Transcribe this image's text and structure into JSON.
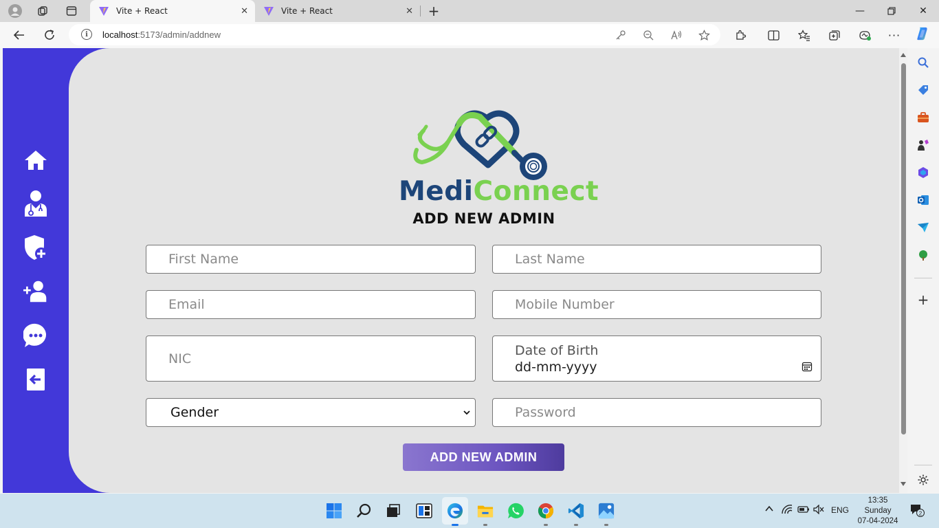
{
  "browser": {
    "tabs": [
      {
        "title": "Vite + React",
        "active": true
      },
      {
        "title": "Vite + React",
        "active": false
      }
    ],
    "url_host": "localhost",
    "url_rest": ":5173/admin/addnew"
  },
  "sidebar": {
    "items": [
      "home-icon",
      "doctors-icon",
      "add-department-icon",
      "add-admin-icon",
      "messages-icon",
      "logout-icon"
    ]
  },
  "brand": {
    "part1": "Medi",
    "part2": "Connect",
    "colors": {
      "primary": "#1d4579",
      "accent": "#7ad150"
    }
  },
  "form": {
    "title": "ADD NEW ADMIN",
    "first_name_placeholder": "First Name",
    "last_name_placeholder": "Last Name",
    "email_placeholder": "Email",
    "mobile_placeholder": "Mobile Number",
    "nic_placeholder": "NIC",
    "dob_label": "Date of Birth",
    "dob_value": "dd-mm-yyyy",
    "gender_value": "Gender",
    "password_placeholder": "Password",
    "submit_label": "ADD NEW ADMIN"
  },
  "theme": {
    "sidebar_bg": "#4238d9",
    "content_bg": "#e4e4e4"
  },
  "taskbar": {
    "language": "ENG",
    "time": "13:35",
    "day": "Sunday",
    "date": "07-04-2024",
    "notification_count": "2"
  }
}
